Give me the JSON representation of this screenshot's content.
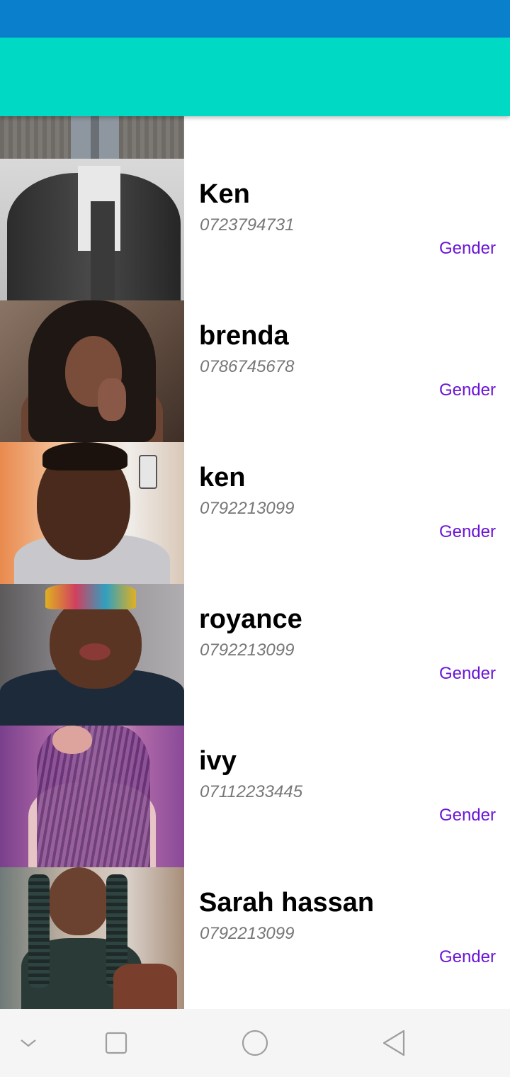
{
  "contacts": [
    {
      "name": "Ken",
      "phone": "0723794731",
      "gender_label": "Gender"
    },
    {
      "name": "brenda",
      "phone": "0786745678",
      "gender_label": "Gender"
    },
    {
      "name": "ken",
      "phone": "0792213099",
      "gender_label": "Gender"
    },
    {
      "name": "royance",
      "phone": "0792213099",
      "gender_label": "Gender"
    },
    {
      "name": "ivy",
      "phone": "07112233445",
      "gender_label": "Gender"
    },
    {
      "name": "Sarah hassan",
      "phone": "0792213099",
      "gender_label": "Gender"
    }
  ],
  "colors": {
    "status_bar": "#0a7fcb",
    "app_bar": "#00d9c4",
    "gender_link": "#6a14d6",
    "phone_text": "#777777"
  },
  "nav": {
    "icons": [
      "chevron-down-icon",
      "recent-apps-icon",
      "home-icon",
      "back-icon"
    ]
  }
}
